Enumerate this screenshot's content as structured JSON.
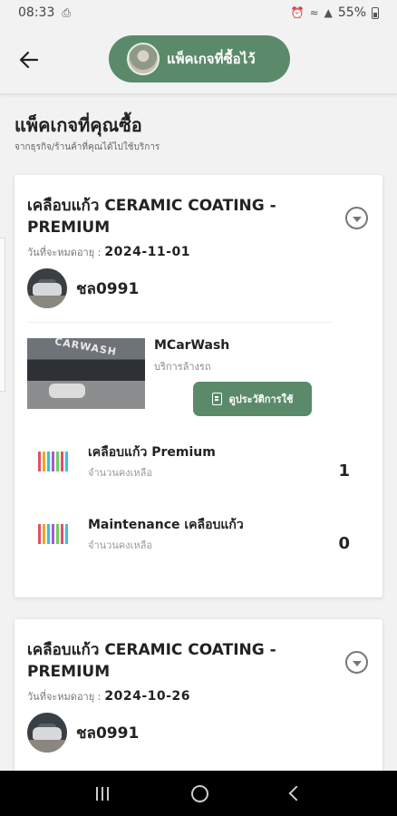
{
  "status_bar": {
    "time": "08:33",
    "battery": "55%"
  },
  "header": {
    "title": "แพ็คเกจที่ซื้อไว้"
  },
  "page": {
    "title": "แพ็คเกจที่คุณซื้อ",
    "subtitle": "จากธุรกิจ/ร้านค้าที่คุณได้ไปใช้บริการ"
  },
  "packages": [
    {
      "title": "เคลือบแก้ว CERAMIC COATING - PREMIUM",
      "expire_label": "วันที่จะหมดอายุ :",
      "expire_date": "2024-11-01",
      "plate": "ชล0991",
      "shop": {
        "name": "MCarWash",
        "type": "บริการล้างรถ",
        "sign_text": "CARWASH"
      },
      "use_button": "ดูประวัติการใช้",
      "services": [
        {
          "name": "เคลือบแก้ว Premium",
          "sub": "จำนวนคงเหลือ",
          "count": "1"
        },
        {
          "name": "Maintenance เคลือบแก้ว",
          "sub": "จำนวนคงเหลือ",
          "count": "0"
        }
      ]
    },
    {
      "title": "เคลือบแก้ว CERAMIC COATING - PREMIUM",
      "expire_label": "วันที่จะหมดอายุ :",
      "expire_date": "2024-10-26",
      "plate": "ชล0991"
    }
  ]
}
